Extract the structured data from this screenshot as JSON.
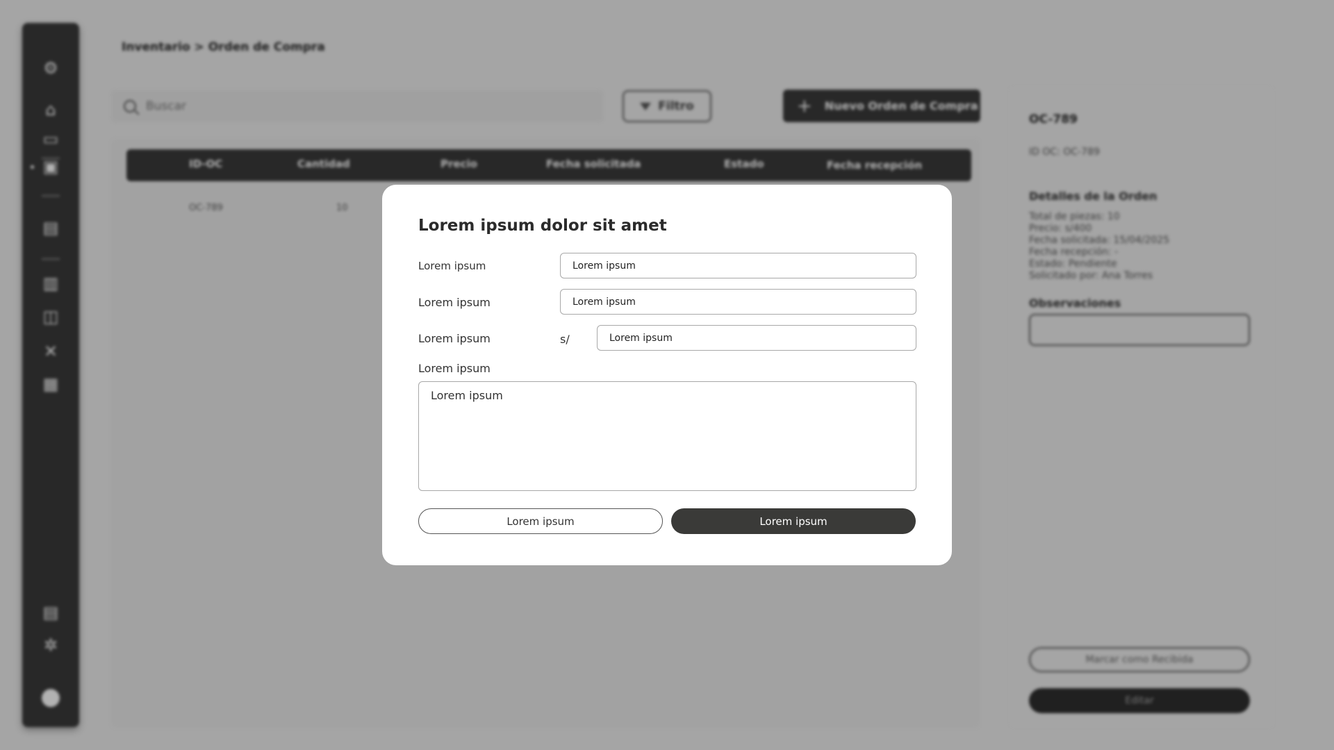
{
  "breadcrumb": "Inventario > Orden de Compra",
  "search": {
    "placeholder": "Buscar"
  },
  "toolbar": {
    "filter_label": "Filtro",
    "new_label": "Nuevo Orden de Compra"
  },
  "table": {
    "headers": [
      "ID-OC",
      "Cantidad",
      "Precio",
      "Fecha solicitada",
      "Estado",
      "Fecha recepción"
    ],
    "rows": [
      {
        "id": "OC-789",
        "cantidad": "10"
      }
    ]
  },
  "details": {
    "title": "OC-789",
    "id_line": "ID OC: OC-789",
    "section_title": "Detalles de la Orden",
    "lines": [
      "Total de piezas: 10",
      "Precio: s/400",
      "Fecha solicitada: 15/04/2025",
      "Fecha recepción: -",
      "Estado: Pendiente",
      "Solicitado por: Ana Torres"
    ],
    "observations_label": "Observaciones",
    "mark_received_label": "Marcar como Recibida",
    "edit_label": "Editar"
  },
  "modal": {
    "title": "Lorem ipsum dolor sit amet",
    "field1_label": "Lorem ipsum",
    "field1_value": "Lorem ipsum",
    "field2_label": "Lorem ipsum",
    "field2_value": "Lorem ipsum",
    "field3_label": "Lorem ipsum",
    "field3_prefix": "s/",
    "field3_value": "Lorem ipsum",
    "textarea_label": "Lorem ipsum",
    "textarea_value": "Lorem ipsum",
    "cancel_label": "Lorem ipsum",
    "confirm_label": "Lorem ipsum"
  },
  "icons": {
    "sidebar": [
      "logo-icon",
      "home-icon",
      "calendar-icon",
      "inventory-icon",
      "report-icon",
      "document-icon",
      "inbox-icon",
      "tools-icon",
      "dashboard-icon",
      "stats-icon",
      "gear-icon",
      "user-icon"
    ]
  },
  "colors": {
    "dark": "#3a3a3a",
    "modal_bg": "#ffffff",
    "overlay": "rgba(0,0,0,0.30)"
  }
}
